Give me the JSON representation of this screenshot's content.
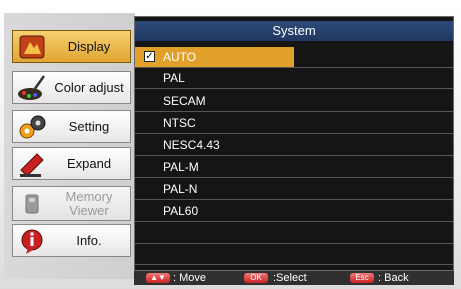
{
  "sidebar": {
    "items": [
      {
        "label": "Display",
        "icon": "display-icon",
        "state": "active"
      },
      {
        "label": "Color adjust",
        "icon": "color-adjust-icon",
        "state": "normal"
      },
      {
        "label": "Setting",
        "icon": "setting-icon",
        "state": "normal"
      },
      {
        "label": "Expand",
        "icon": "expand-icon",
        "state": "normal"
      },
      {
        "label": "Memory\nViewer",
        "icon": "memory-viewer-icon",
        "state": "disabled"
      },
      {
        "label": "Info.",
        "icon": "info-icon",
        "state": "normal"
      }
    ]
  },
  "panel": {
    "title": "System",
    "options": [
      "AUTO",
      "PAL",
      "SECAM",
      "NTSC",
      "NESC4.43",
      "PAL-M",
      "PAL-N",
      "PAL60"
    ],
    "selected": "AUTO",
    "check_mark": "✓"
  },
  "footer": {
    "move_key": "▲▼",
    "move_label": ": Move",
    "select_key": "OK",
    "select_label": ":Select",
    "back_key": "Esc",
    "back_label": ": Back"
  },
  "colors": {
    "active_tab": "#e1a531",
    "title_bar": "#2d4c79",
    "selection": "#e1a02a",
    "panel_bg": "#151515",
    "key_red": "#c82020"
  }
}
